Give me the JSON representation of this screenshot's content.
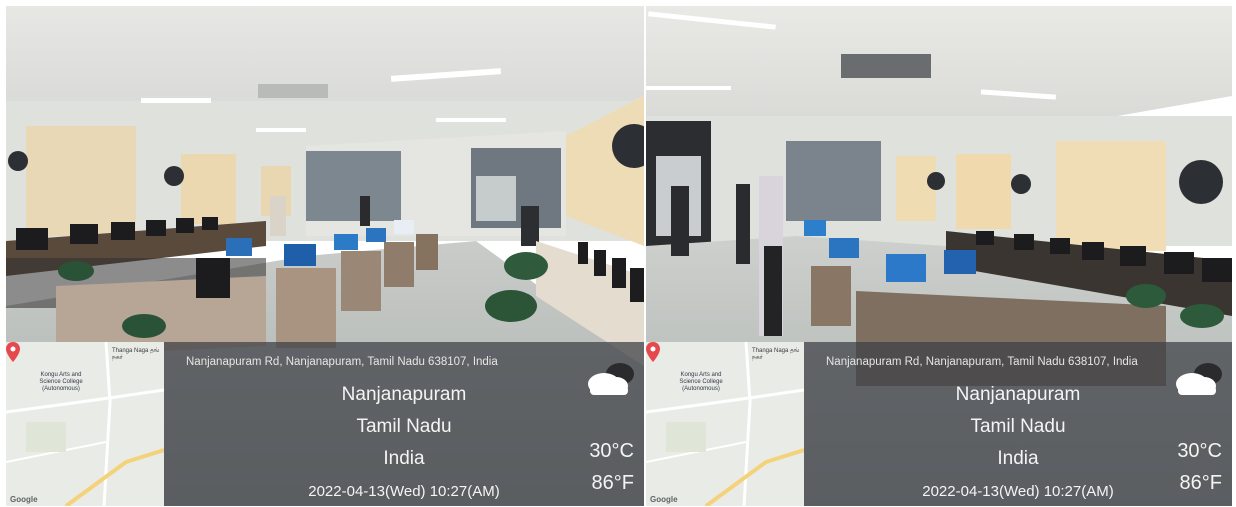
{
  "panels": [
    {
      "address": "Nanjanapuram Rd, Nanjanapuram, Tamil Nadu 638107, India",
      "city": "Nanjanapuram",
      "state": "Tamil Nadu",
      "country": "India",
      "datetime": "2022-04-13(Wed)   10:27(AM)",
      "temp_c": "30°C",
      "temp_f": "86°F",
      "weather_icon": "partly-cloudy-icon",
      "map": {
        "campus_label": "Kongu Arts and Science College (Autonomous)",
        "town_label": "Thanga Naga தங் நகர்",
        "attribution": "Google"
      }
    },
    {
      "address": "Nanjanapuram Rd, Nanjanapuram, Tamil Nadu 638107, India",
      "city": "Nanjanapuram",
      "state": "Tamil Nadu",
      "country": "India",
      "datetime": "2022-04-13(Wed)   10:27(AM)",
      "temp_c": "30°C",
      "temp_f": "86°F",
      "weather_icon": "partly-cloudy-icon",
      "map": {
        "campus_label": "Kongu Arts and Science College (Autonomous)",
        "town_label": "Thanga Naga தங் நகர்",
        "attribution": "Google"
      }
    }
  ]
}
